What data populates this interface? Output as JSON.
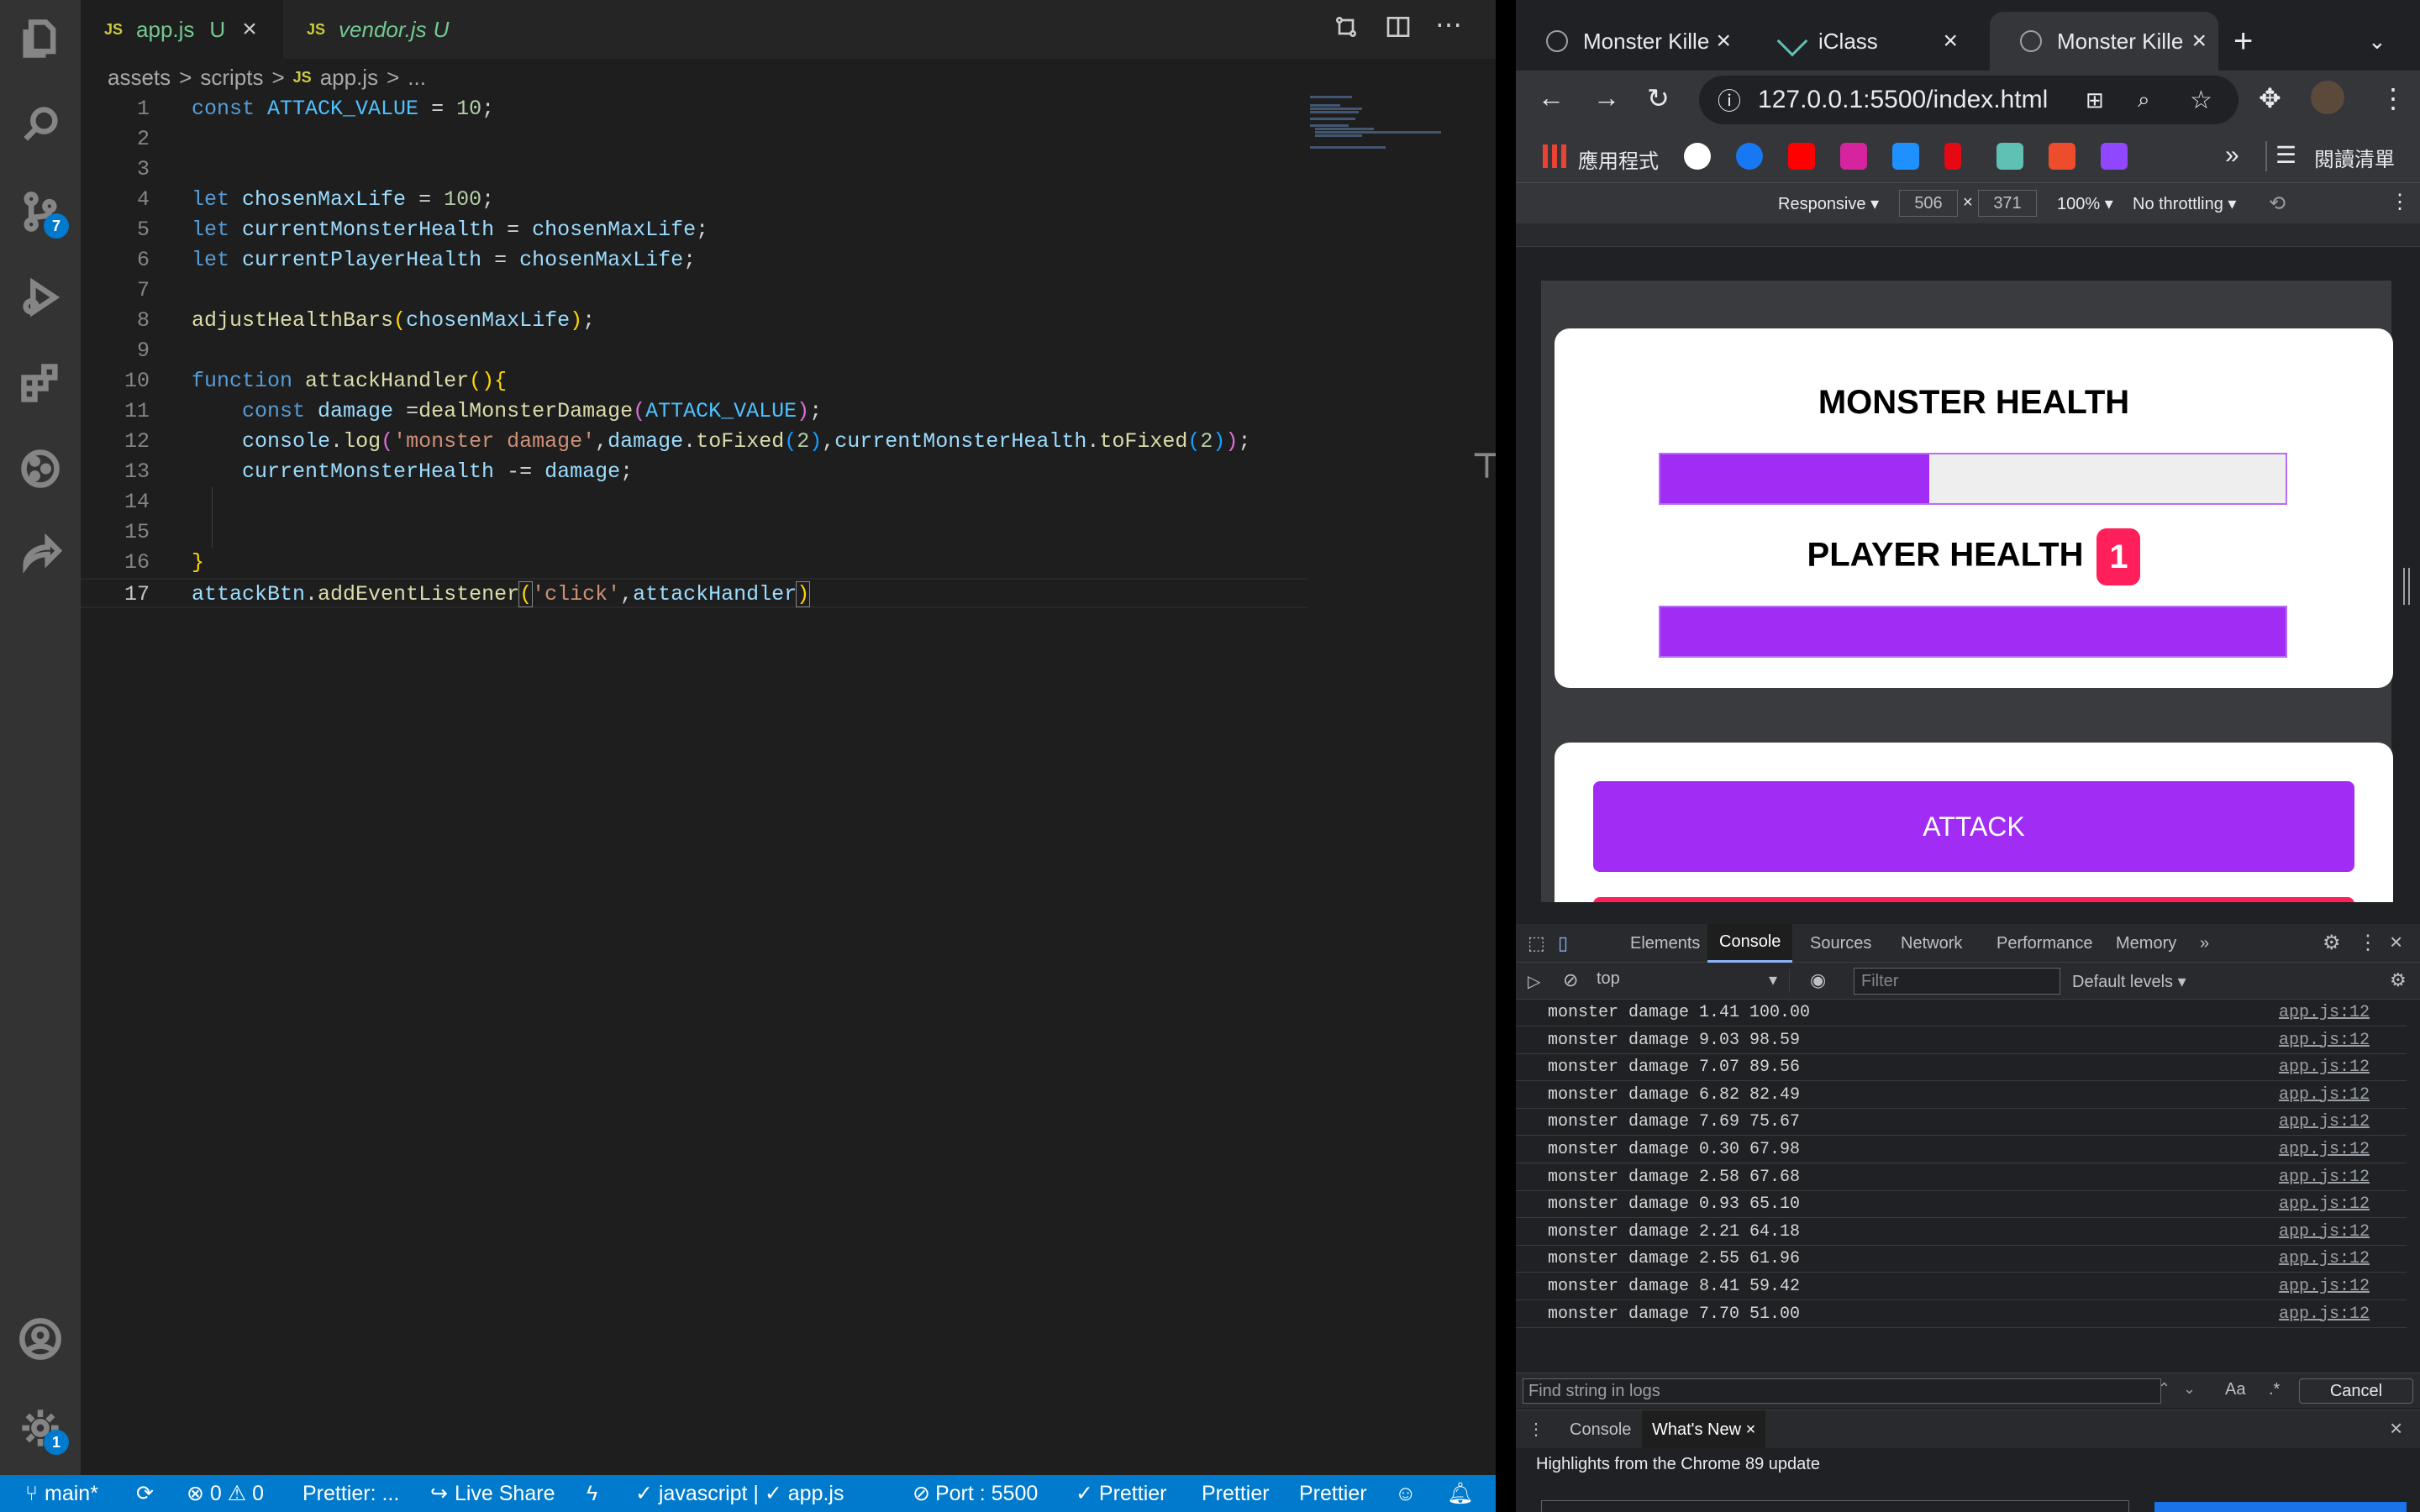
{
  "vscode": {
    "tabs": [
      {
        "icon": "JS",
        "label": "app.js",
        "status": "U",
        "close": "×"
      },
      {
        "icon": "JS",
        "label": "vendor.js",
        "status": "U"
      }
    ],
    "breadcrumb": [
      "assets",
      "scripts",
      "app.js",
      "..."
    ],
    "breadcrumb_sep": ">",
    "activity_badges": {
      "source_control": "7",
      "settings": "1"
    },
    "code_lines": [
      {
        "n": "1"
      },
      {
        "n": "2"
      },
      {
        "n": "3"
      },
      {
        "n": "4"
      },
      {
        "n": "5"
      },
      {
        "n": "6"
      },
      {
        "n": "7"
      },
      {
        "n": "8"
      },
      {
        "n": "9"
      },
      {
        "n": "10"
      },
      {
        "n": "11"
      },
      {
        "n": "12"
      },
      {
        "n": "13"
      },
      {
        "n": "14"
      },
      {
        "n": "15"
      },
      {
        "n": "16"
      },
      {
        "n": "17"
      }
    ],
    "code": {
      "l1_kw": "const",
      "l1_name": "ATTACK_VALUE",
      "l1_eq": " = ",
      "l1_num": "10",
      "l1_end": ";",
      "l4_kw": "let",
      "l4_name": "chosenMaxLife",
      "l4_eq": " = ",
      "l4_num": "100",
      "l4_end": ";",
      "l5_kw": "let",
      "l5_name": "currentMonsterHealth",
      "l5_eq": " = ",
      "l5_val": "chosenMaxLife",
      "l5_end": ";",
      "l6_kw": "let",
      "l6_name": "currentPlayerHealth",
      "l6_eq": " = ",
      "l6_val": "chosenMaxLife",
      "l6_end": ";",
      "l8_fn": "adjustHealthBars",
      "l8_open": "(",
      "l8_arg": "chosenMaxLife",
      "l8_close": ")",
      "l8_end": ";",
      "l10_kw": "function",
      "l10_fn": "attackHandler",
      "l10_paren": "()",
      "l10_brace": "{",
      "l11_kw": "const",
      "l11_name": "damage",
      "l11_eq": " =",
      "l11_fn": "dealMonsterDamage",
      "l11_open": "(",
      "l11_arg": "ATTACK_VALUE",
      "l11_close": ")",
      "l11_end": ";",
      "l12_obj": "console",
      "l12_dot": ".",
      "l12_fn": "log",
      "l12_open": "(",
      "l12_str": "'monster damage'",
      "l12_c1": ",",
      "l12_a1": "damage",
      "l12_d1": ".",
      "l12_f1": "toFixed",
      "l12_o1": "(",
      "l12_n1": "2",
      "l12_x1": ")",
      "l12_c2": ",",
      "l12_a2": "currentMonsterHealth",
      "l12_d2": ".",
      "l12_f2": "toFixed",
      "l12_o2": "(",
      "l12_n2": "2",
      "l12_x2": ")",
      "l12_close": ")",
      "l12_end": ";",
      "l13_name": "currentMonsterHealth",
      "l13_op": " -= ",
      "l13_val": "damage",
      "l13_end": ";",
      "l16_brace": "}",
      "l17_obj": "attackBtn",
      "l17_dot": ".",
      "l17_fn": "addEventListener",
      "l17_open": "(",
      "l17_str": "'click'",
      "l17_comma": ",",
      "l17_arg": "attackHandler",
      "l17_close": ")"
    },
    "status_bar": {
      "branch": "main*",
      "problems": "⊗ 0 ⚠ 0",
      "prettier1": "Prettier: ...",
      "live_share": "Live Share",
      "language": "✓ javascript | ✓ app.js",
      "port": "Port : 5500",
      "prettier2": "✓ Prettier",
      "prettier3": "Prettier",
      "prettier4": "Prettier"
    }
  },
  "chrome": {
    "tabs": [
      {
        "label": "Monster Kille"
      },
      {
        "label": "iClass"
      },
      {
        "label": "Monster Kille"
      }
    ],
    "url": "127.0.0.1:5500/index.html",
    "bookmarks_apps": "應用程式",
    "reading_list": "閱讀清單",
    "more_bookmarks": "»",
    "device_toolbar": {
      "mode": "Responsive",
      "width": "506",
      "height": "371",
      "times": "×",
      "zoom": "100%",
      "throttle": "No throttling"
    },
    "game": {
      "monster_title": "MONSTER HEALTH",
      "player_title": "PLAYER HEALTH",
      "player_badge": "1",
      "monster_health_fraction": 0.43,
      "player_health_fraction": 1.0,
      "attack_label": "ATTACK"
    },
    "devtools": {
      "tabs": [
        "Elements",
        "Console",
        "Sources",
        "Network",
        "Performance",
        "Memory",
        "»"
      ],
      "active_tab": "Console",
      "context": "top",
      "filter_placeholder": "Filter",
      "levels": "Default levels",
      "logs": [
        {
          "msg": "monster damage 1.41 100.00",
          "src": "app.js:12"
        },
        {
          "msg": "monster damage 9.03 98.59",
          "src": "app.js:12"
        },
        {
          "msg": "monster damage 7.07 89.56",
          "src": "app.js:12"
        },
        {
          "msg": "monster damage 6.82 82.49",
          "src": "app.js:12"
        },
        {
          "msg": "monster damage 7.69 75.67",
          "src": "app.js:12"
        },
        {
          "msg": "monster damage 0.30 67.98",
          "src": "app.js:12"
        },
        {
          "msg": "monster damage 2.58 67.68",
          "src": "app.js:12"
        },
        {
          "msg": "monster damage 0.93 65.10",
          "src": "app.js:12"
        },
        {
          "msg": "monster damage 2.21 64.18",
          "src": "app.js:12"
        },
        {
          "msg": "monster damage 2.55 61.96",
          "src": "app.js:12"
        },
        {
          "msg": "monster damage 8.41 59.42",
          "src": "app.js:12"
        },
        {
          "msg": "monster damage 7.70 51.00",
          "src": "app.js:12"
        }
      ],
      "prompt": "›",
      "find_placeholder": "Find string in logs",
      "aa": "Aa",
      "regex": ".*",
      "cancel": "Cancel",
      "drawer_tabs": [
        "Console",
        "What's New"
      ],
      "whats_new": "Highlights from the Chrome 89 update"
    }
  }
}
